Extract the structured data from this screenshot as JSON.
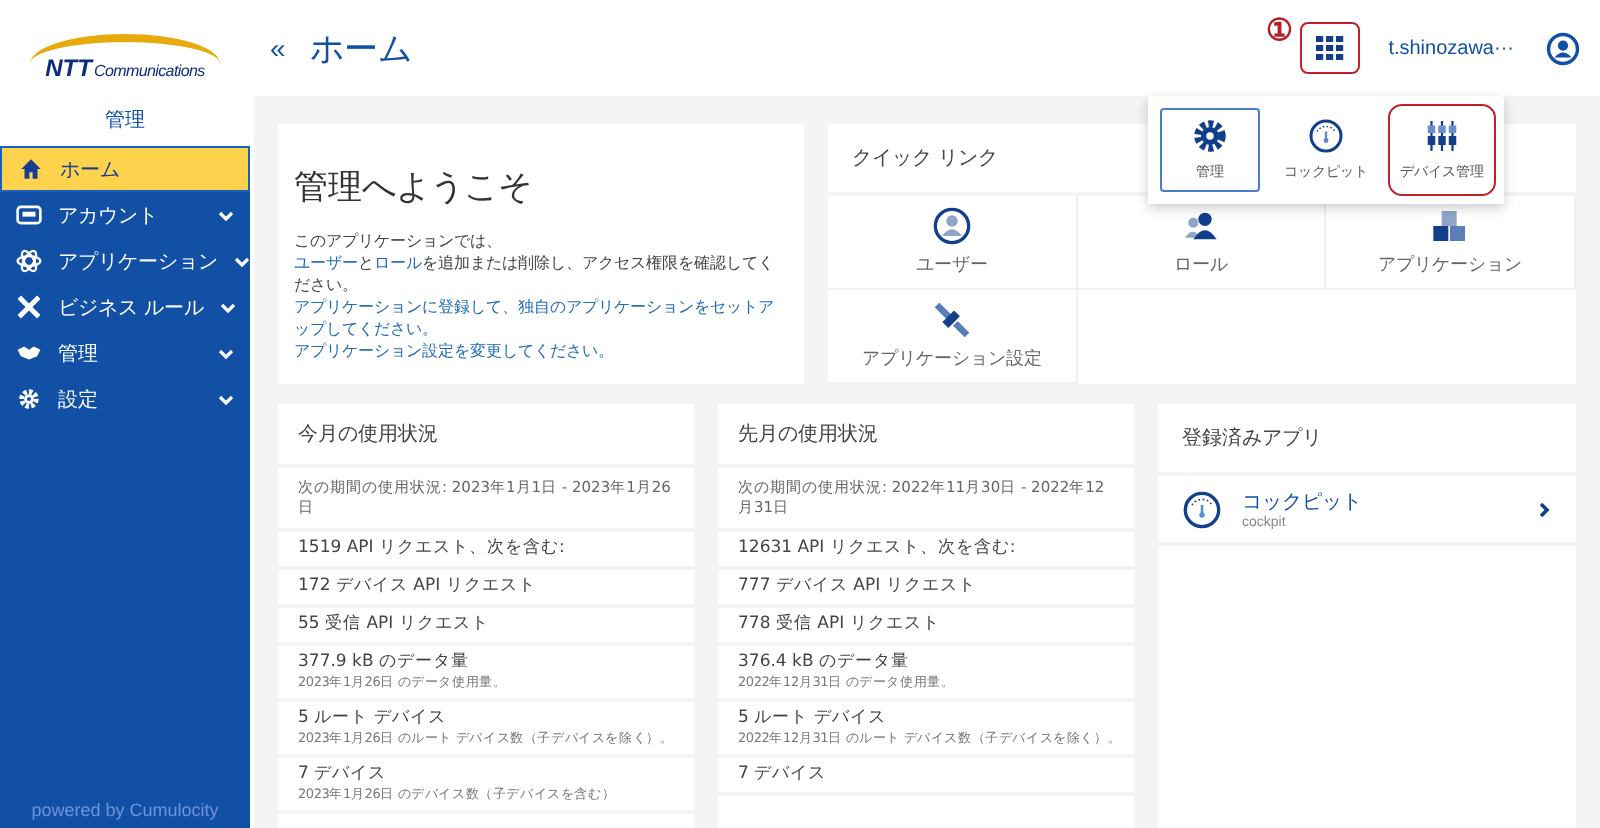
{
  "sidebar": {
    "logo": {
      "mark": "NTT",
      "name": "Communications"
    },
    "app_name": "管理",
    "items": [
      {
        "label": "ホーム",
        "selected": true,
        "expandable": false
      },
      {
        "label": "アカウント",
        "selected": false,
        "expandable": true
      },
      {
        "label": "アプリケーション",
        "selected": false,
        "expandable": true
      },
      {
        "label": "ビジネス ルール",
        "selected": false,
        "expandable": true
      },
      {
        "label": "管理",
        "selected": false,
        "expandable": true
      },
      {
        "label": "設定",
        "selected": false,
        "expandable": true
      }
    ],
    "footer": "powered by Cumulocity"
  },
  "header": {
    "collapse": "«",
    "title": "ホーム",
    "annotation": "①",
    "apps_button": {
      "highlighted": true
    },
    "user": "t.shinozawa···"
  },
  "app_switcher": [
    {
      "label": "管理",
      "selected": true,
      "highlighted": false
    },
    {
      "label": "コックピット",
      "selected": false,
      "highlighted": false
    },
    {
      "label": "デバイス管理",
      "selected": false,
      "highlighted": true
    }
  ],
  "welcome": {
    "title": "管理へようこそ",
    "lines": [
      [
        {
          "kind": "text",
          "text": "このアプリケーションでは、"
        }
      ],
      [
        {
          "kind": "link",
          "text": "ユーザー"
        },
        {
          "kind": "text",
          "text": "と"
        },
        {
          "kind": "link",
          "text": "ロール"
        },
        {
          "kind": "text",
          "text": "を追加または削除し、アクセス権限を確認してください。"
        }
      ],
      [
        {
          "kind": "link",
          "text": "アプリケーションに登録して、独自のアプリケーションをセットアップしてください。"
        }
      ],
      [
        {
          "kind": "link",
          "text": "アプリケーション設定を変更してください。"
        }
      ]
    ]
  },
  "quick_links": {
    "title": "クイック リンク",
    "items": [
      {
        "label": "ユーザー"
      },
      {
        "label": "ロール"
      },
      {
        "label": "アプリケーション"
      },
      {
        "label": "アプリケーション設定"
      }
    ]
  },
  "usage_cards": [
    {
      "title": "今月の使用状況",
      "period": "次の期間の使用状況: 2023年1月1日 - 2023年1月26日",
      "rows": [
        {
          "main": "1519 API リクエスト、次を含む:"
        },
        {
          "main": "172 デバイス API リクエスト"
        },
        {
          "main": "55 受信 API リクエスト"
        },
        {
          "main": "377.9 kB のデータ量",
          "sub": "2023年1月26日 のデータ使用量。"
        },
        {
          "main": "5 ルート デバイス",
          "sub": "2023年1月26日 のルート デバイス数（子デバイスを除く）。"
        },
        {
          "main": "7 デバイス",
          "sub": "2023年1月26日 のデバイス数（子デバイスを含む）"
        }
      ]
    },
    {
      "title": "先月の使用状況",
      "period": "次の期間の使用状況: 2022年11月30日 - 2022年12月31日",
      "rows": [
        {
          "main": "12631 API リクエスト、次を含む:"
        },
        {
          "main": "777 デバイス API リクエスト"
        },
        {
          "main": "778 受信 API リクエスト"
        },
        {
          "main": "376.4 kB のデータ量",
          "sub": "2022年12月31日 のデータ使用量。"
        },
        {
          "main": "5 ルート デバイス",
          "sub": "2022年12月31日 のルート デバイス数（子デバイスを除く）。"
        },
        {
          "main": "7 デバイス"
        }
      ]
    }
  ],
  "registered_apps": {
    "title": "登録済みアプリ",
    "items": [
      {
        "name": "コックピット",
        "sub": "cockpit"
      }
    ]
  }
}
